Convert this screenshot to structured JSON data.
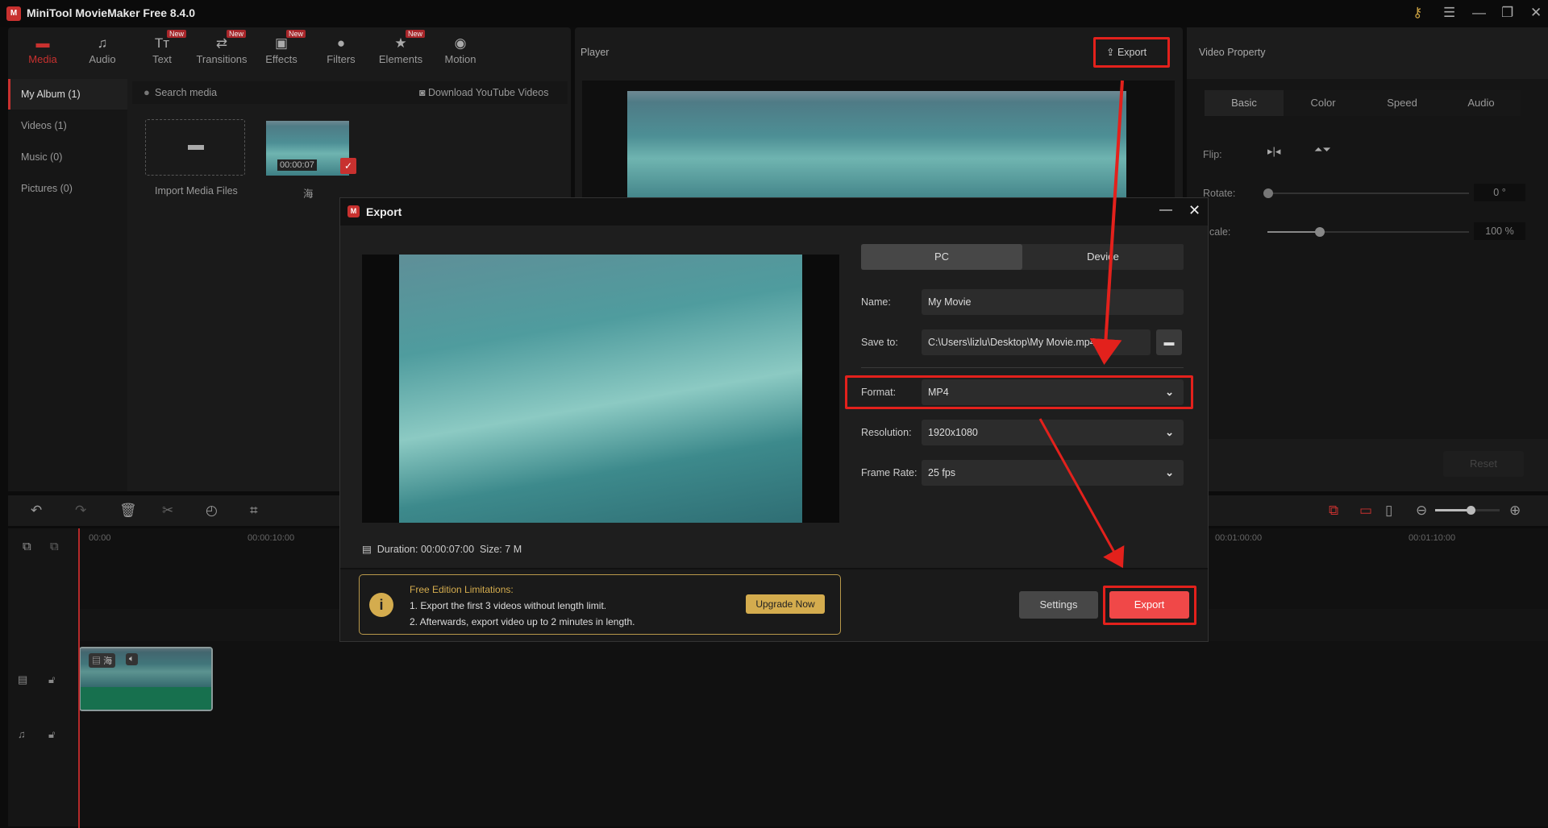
{
  "app": {
    "title": "MiniTool MovieMaker Free 8.4.0",
    "logo": "MT"
  },
  "toolbar_tabs": [
    {
      "label": "Media",
      "icon": "folder-icon",
      "new": false
    },
    {
      "label": "Audio",
      "icon": "music-icon",
      "new": false
    },
    {
      "label": "Text",
      "icon": "text-icon",
      "new": true
    },
    {
      "label": "Transitions",
      "icon": "swap-icon",
      "new": true
    },
    {
      "label": "Effects",
      "icon": "effects-icon",
      "new": true
    },
    {
      "label": "Filters",
      "icon": "filters-icon",
      "new": false
    },
    {
      "label": "Elements",
      "icon": "elements-icon",
      "new": true
    },
    {
      "label": "Motion",
      "icon": "motion-icon",
      "new": false
    }
  ],
  "new_badge": "New",
  "sidebar": [
    "My Album (1)",
    "Videos (1)",
    "Music (0)",
    "Pictures (0)"
  ],
  "media": {
    "search_placeholder": "Search media",
    "download": "Download YouTube Videos",
    "import": "Import Media Files",
    "clip_duration": "00:00:07",
    "clip_name": "海"
  },
  "player": {
    "title": "Player",
    "export": "Export"
  },
  "property": {
    "title": "Video Property",
    "tabs": [
      "Basic",
      "Color",
      "Speed",
      "Audio"
    ],
    "flip": "Flip:",
    "rotate": "Rotate:",
    "rotate_value": "0 °",
    "scale": "cale:",
    "scale_value": "100 %",
    "reset": "Reset",
    "rotate_fraction": 0,
    "scale_fraction": 0.25
  },
  "timeline": {
    "ticks": [
      "00:00",
      "00:00:10:00",
      "00:01:00:00",
      "00:01:10:00"
    ],
    "clip_name": "海",
    "zoom_fraction": 0.55
  },
  "dialog": {
    "title": "Export",
    "tabs": [
      "PC",
      "Device"
    ],
    "name_label": "Name:",
    "name": "My Movie",
    "save_label": "Save to:",
    "save_path": "C:\\Users\\lizlu\\Desktop\\My Movie.mp4",
    "format_label": "Format:",
    "format": "MP4",
    "resolution_label": "Resolution:",
    "resolution": "1920x1080",
    "framerate_label": "Frame Rate:",
    "framerate": "25 fps",
    "duration_label": "Duration:",
    "duration": "00:00:07:00",
    "size_label": "Size:",
    "size": "7 M",
    "limit_title": "Free Edition Limitations:",
    "limit_1": "1. Export the first 3 videos without length limit.",
    "limit_2": "2. Afterwards, export video up to 2 minutes in length.",
    "upgrade": "Upgrade Now",
    "settings": "Settings",
    "export": "Export"
  },
  "colors": {
    "accent": "#c8312f",
    "export_btn": "#f04848",
    "gold": "#d4ac4e",
    "annotation": "#e3211c"
  }
}
